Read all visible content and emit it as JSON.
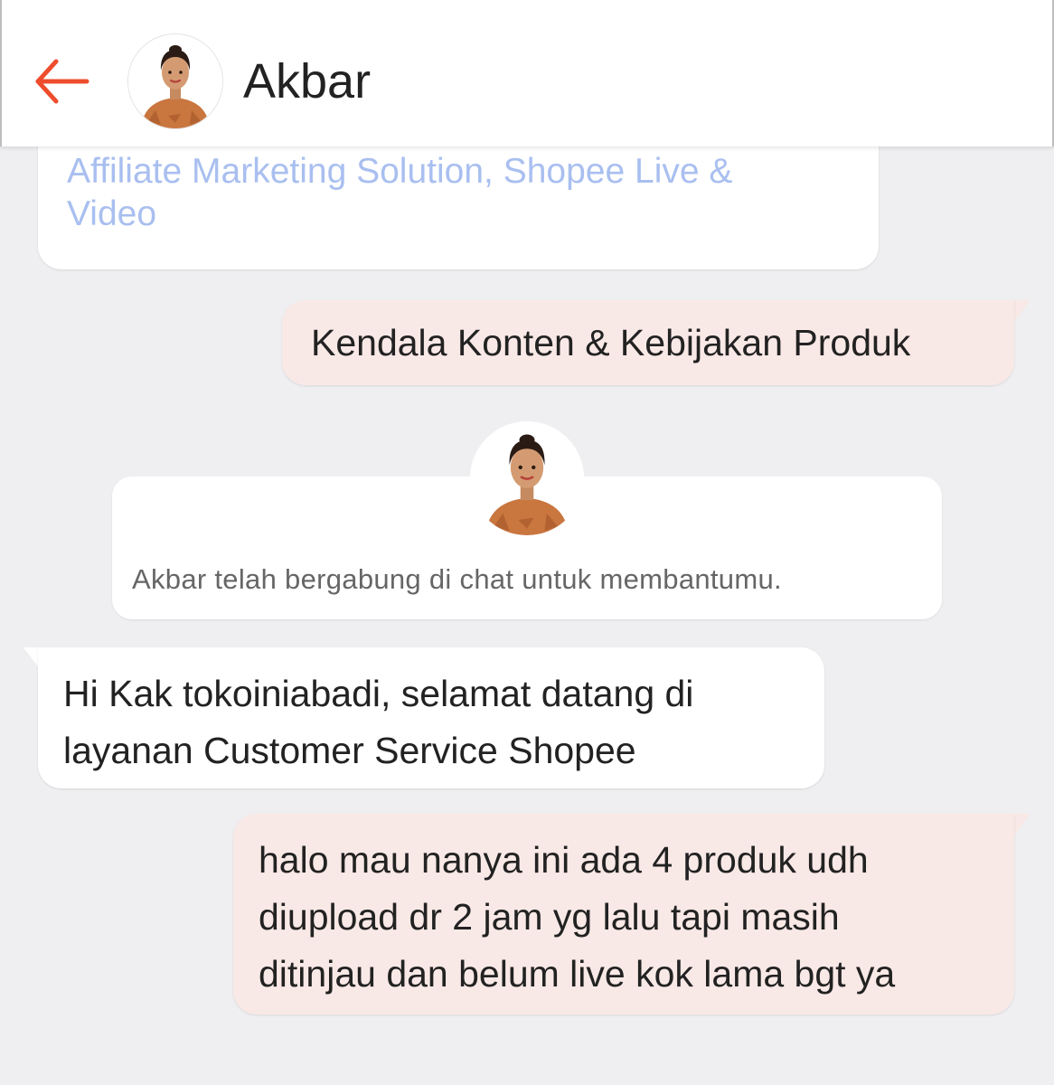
{
  "header": {
    "title": "Akbar",
    "back_icon": "arrow-left-icon",
    "accent_color": "#ee4d2d"
  },
  "messages": [
    {
      "sender": "agent",
      "kind": "link-card",
      "text": "Affiliate Marketing Solution, Shopee Live &\nVideo"
    },
    {
      "sender": "user",
      "kind": "text",
      "text": "Kendala Konten & Kebijakan Produk"
    },
    {
      "sender": "system",
      "kind": "join-notice",
      "text": "Akbar telah bergabung di chat untuk membantumu."
    },
    {
      "sender": "agent",
      "kind": "text",
      "text": "Hi Kak tokoiniabadi, selamat datang di\nlayanan Customer Service Shopee"
    },
    {
      "sender": "user",
      "kind": "text",
      "text": "halo mau nanya ini ada 4 produk udh\ndiupload dr 2 jam yg lalu tapi masih\nditinjau dan belum live kok lama bgt ya"
    }
  ],
  "colors": {
    "background": "#efeff1",
    "incoming_bubble": "#ffffff",
    "outgoing_bubble": "#f9e9e6",
    "link_text": "#a9bff0"
  }
}
